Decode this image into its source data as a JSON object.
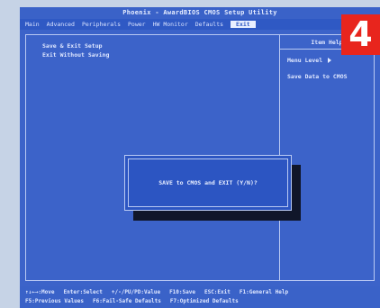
{
  "bios": {
    "title": "Phoenix - AwardBIOS CMOS Setup Utility",
    "menu": [
      {
        "label": "Main",
        "active": false
      },
      {
        "label": "Advanced",
        "active": false
      },
      {
        "label": "Peripherals",
        "active": false
      },
      {
        "label": "Power",
        "active": false
      },
      {
        "label": "HW Monitor",
        "active": false
      },
      {
        "label": "Defaults",
        "active": false
      },
      {
        "label": "Exit",
        "active": true
      }
    ],
    "options": [
      {
        "label": "Save & Exit Setup"
      },
      {
        "label": "Exit Without Saving"
      }
    ],
    "help": {
      "header": "Item Help",
      "menu_level": "Menu Level",
      "description": "Save Data to CMOS"
    },
    "dialog": {
      "prompt": "SAVE to CMOS and EXIT (Y/N)?"
    },
    "footer": {
      "row1": [
        "↑↓←→:Move",
        "Enter:Select",
        "+/-/PU/PD:Value",
        "F10:Save",
        "ESC:Exit",
        "F1:General Help"
      ],
      "row2": [
        "F5:Previous Values",
        "F6:Fail-Safe Defaults",
        "F7:Optimized Defaults"
      ]
    }
  },
  "badge": {
    "number": "4",
    "color": "#e8251d"
  }
}
